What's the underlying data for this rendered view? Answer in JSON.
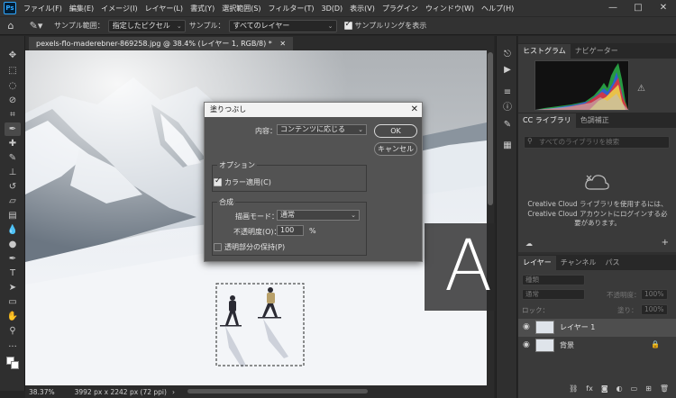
{
  "app": {
    "logo": "Ps"
  },
  "menu": [
    "ファイル(F)",
    "編集(E)",
    "イメージ(I)",
    "レイヤー(L)",
    "書式(Y)",
    "選択範囲(S)",
    "フィルター(T)",
    "3D(D)",
    "表示(V)",
    "プラグイン",
    "ウィンドウ(W)",
    "ヘルプ(H)"
  ],
  "window_controls": [
    "—",
    "□",
    "✕"
  ],
  "options_bar": {
    "sample_range_label": "サンプル範囲：",
    "sample_range_value": "指定したピクセル",
    "sample_label": "サンプル：",
    "sample_value": "すべてのレイヤー",
    "show_ring_label": "サンプルリングを表示",
    "show_ring_checked": true
  },
  "document": {
    "tab_label": "pexels-flo-maderebner-869258.jpg @ 38.4% (レイヤー 1, RGB/8) *",
    "zoom": "38.37%",
    "dimensions": "3992 px x 2242 px (72 ppi)"
  },
  "dialog": {
    "title": "塗りつぶし",
    "close": "✕",
    "contents_label": "内容：",
    "contents_value": "コンテンツに応じる",
    "ok_label": "OK",
    "cancel_label": "キャンセル",
    "options_group": "オプション",
    "color_adapt_label": "カラー適用(C)",
    "color_adapt_checked": true,
    "blend_group": "合成",
    "mode_label": "描画モード：",
    "mode_value": "通常",
    "opacity_label": "不透明度(O)：",
    "opacity_value": "100",
    "opacity_unit": "%",
    "preserve_label": "透明部分の保持(P)",
    "preserve_checked": false
  },
  "overlay_letter": "A",
  "panels": {
    "top_tabs": [
      "ヒストグラム",
      "ナビゲーター"
    ],
    "cc_tabs": [
      "CC ライブラリ",
      "色調補正"
    ],
    "cc_search_placeholder": "すべてのライブラリを検索",
    "cc_message": "Creative Cloud ライブラリを使用するには、Creative Cloud アカウントにログインする必要があります。",
    "layers_tabs": [
      "レイヤー",
      "チャンネル",
      "パス"
    ],
    "layers_filter": "種類",
    "blend_mode": "通常",
    "opacity_label": "不透明度：",
    "opacity_value": "100%",
    "lock_label": "ロック：",
    "fill_label": "塗り：",
    "fill_value": "100%",
    "layers": [
      {
        "name": "レイヤー 1",
        "selected": true
      },
      {
        "name": "背景",
        "selected": false,
        "locked": true
      }
    ]
  },
  "colors": {
    "accent": "#31a8ff",
    "panel": "#2f2f2f",
    "dialog": "#535353"
  }
}
